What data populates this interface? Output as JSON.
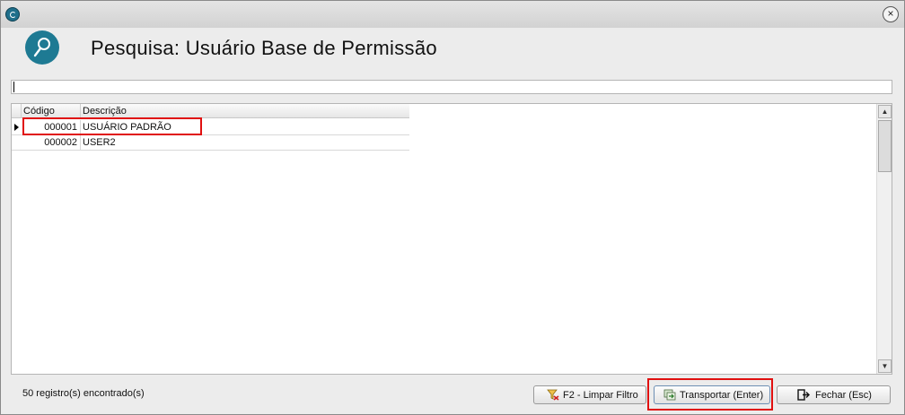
{
  "window": {
    "close_glyph": "×"
  },
  "header": {
    "title": "Pesquisa: Usuário Base de Permissão",
    "icon": "magnifier-icon"
  },
  "filter": {
    "value": "",
    "placeholder": ""
  },
  "grid": {
    "columns": [
      "Código",
      "Descrição"
    ],
    "rows": [
      {
        "code": "000001",
        "description": "USUÁRIO PADRÃO",
        "selected": true
      },
      {
        "code": "000002",
        "description": "USER2",
        "selected": false
      }
    ]
  },
  "status": {
    "text": "50 registro(s) encontrado(s)"
  },
  "buttons": {
    "clear_filter": {
      "label": "F2 - Limpar Filtro",
      "icon": "funnel-clear-icon"
    },
    "transport": {
      "label": "Transportar (Enter)",
      "icon": "transport-icon"
    },
    "close": {
      "label": "Fechar (Esc)",
      "icon": "exit-icon"
    }
  },
  "colors": {
    "accent": "#1e7a93",
    "highlight": "#e01010"
  }
}
